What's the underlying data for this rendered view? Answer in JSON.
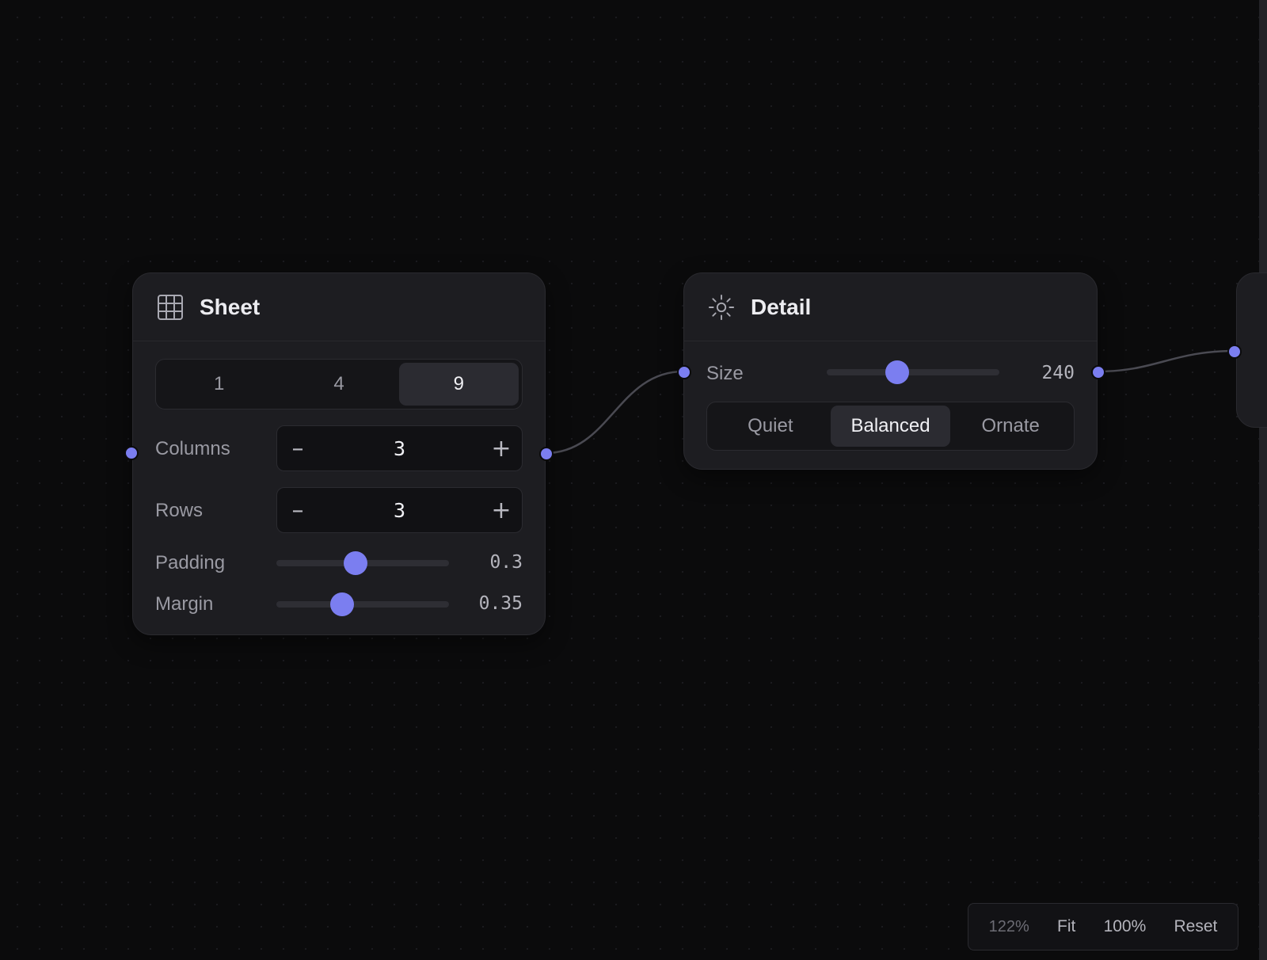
{
  "sheet": {
    "title": "Sheet",
    "icon": "grid-icon",
    "count_options": [
      "1",
      "4",
      "9"
    ],
    "count_selected": "9",
    "columns": {
      "label": "Columns",
      "value": "3",
      "minus": "–",
      "plus": "+"
    },
    "rows": {
      "label": "Rows",
      "value": "3",
      "minus": "–",
      "plus": "+"
    },
    "padding": {
      "label": "Padding",
      "value": "0.3",
      "fraction": 0.46
    },
    "margin": {
      "label": "Margin",
      "value": "0.35",
      "fraction": 0.38
    }
  },
  "detail": {
    "title": "Detail",
    "icon": "sun-icon",
    "size": {
      "label": "Size",
      "value": "240",
      "fraction": 0.41
    },
    "style_options": [
      "Quiet",
      "Balanced",
      "Ornate"
    ],
    "style_selected": "Balanced"
  },
  "zoom": {
    "level": "122%",
    "fit_label": "Fit",
    "hundred_label": "100%",
    "reset_label": "Reset"
  },
  "colors": {
    "accent": "#7b7ef0",
    "background": "#0b0b0c",
    "node_bg": "#1d1d21"
  }
}
